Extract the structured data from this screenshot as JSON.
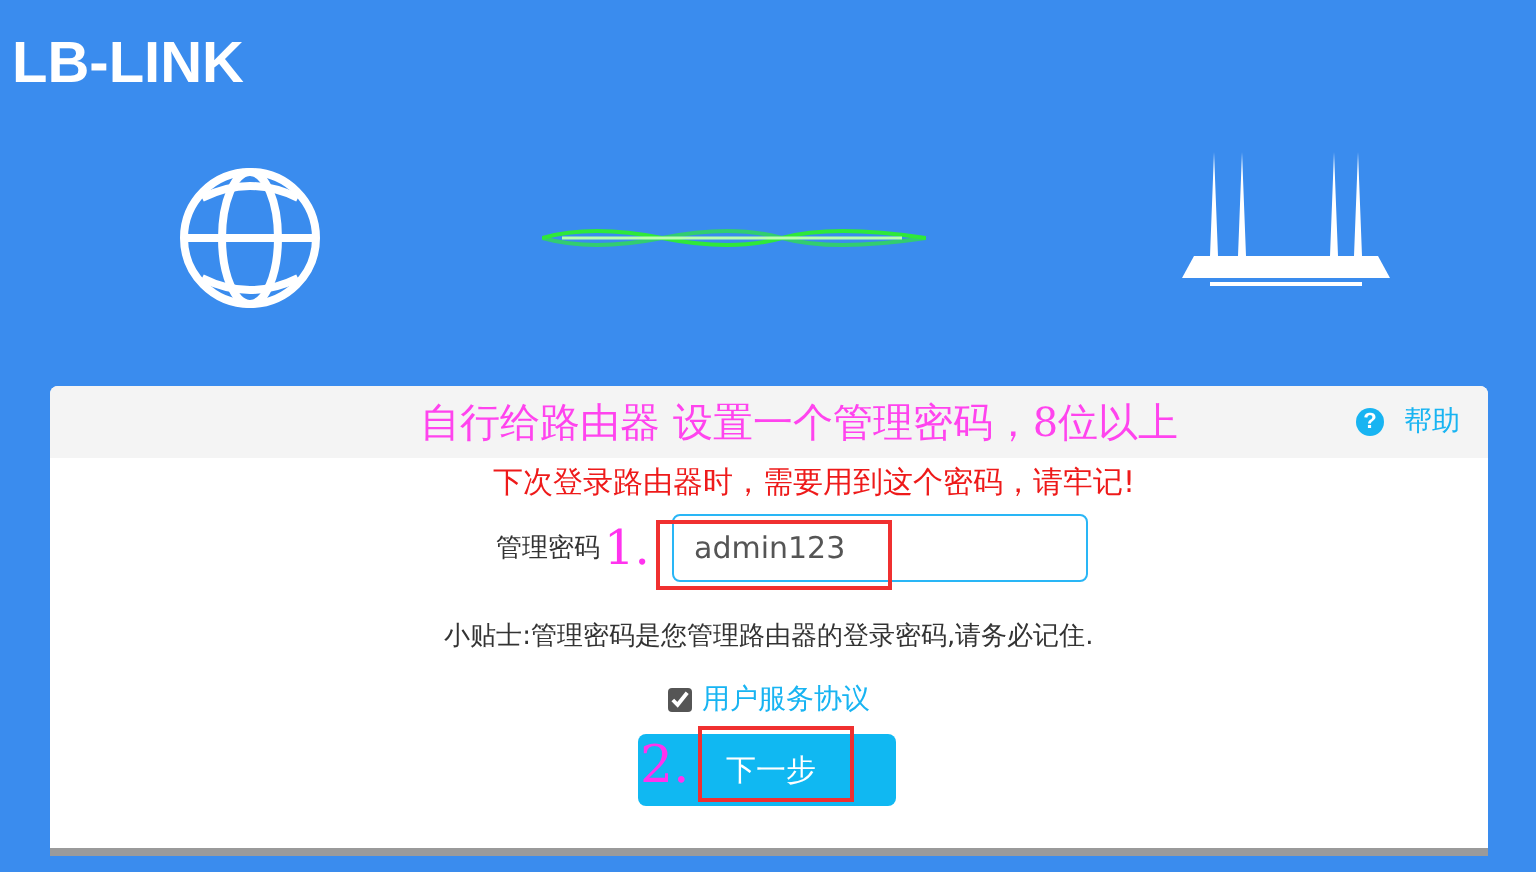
{
  "logo": "LB-LINK",
  "header": {
    "annotation": "自行给路由器  设置一个管理密码，8位以上",
    "help_icon": "?",
    "help": "帮助"
  },
  "note": "下次登录路由器时，需要用到这个密码，请牢记!",
  "password": {
    "label": "管理密码",
    "marker": "1.",
    "value": "admin123"
  },
  "tip": "小贴士:管理密码是您管理路由器的登录密码,请务必记住.",
  "agreement": {
    "label": "用户服务协议",
    "checked": true
  },
  "next": {
    "label": "下一步",
    "marker": "2."
  }
}
